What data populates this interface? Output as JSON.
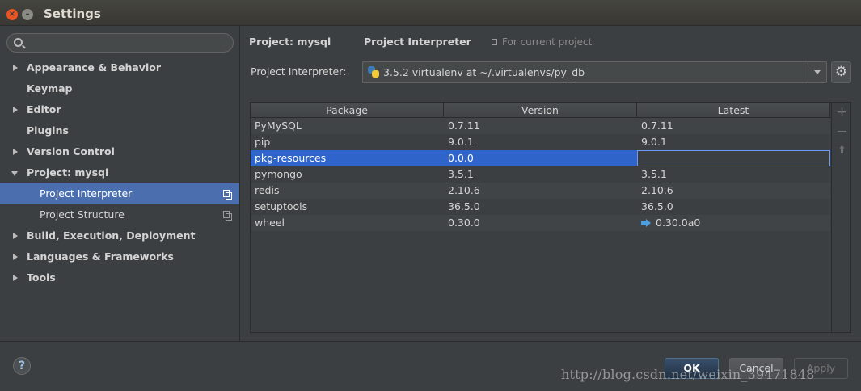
{
  "window": {
    "title": "Settings",
    "close_glyph": "×",
    "minimize_glyph": "–"
  },
  "sidebar": {
    "search_placeholder": "",
    "items": [
      {
        "label": "Appearance & Behavior",
        "expandable": true
      },
      {
        "label": "Keymap",
        "expandable": false
      },
      {
        "label": "Editor",
        "expandable": true
      },
      {
        "label": "Plugins",
        "expandable": false
      },
      {
        "label": "Version Control",
        "expandable": true
      },
      {
        "label": "Project: mysql",
        "expandable": true,
        "expanded": true
      },
      {
        "label": "Project Interpreter",
        "child": true,
        "selected": true
      },
      {
        "label": "Project Structure",
        "child": true
      },
      {
        "label": "Build, Execution, Deployment",
        "expandable": true
      },
      {
        "label": "Languages & Frameworks",
        "expandable": true
      },
      {
        "label": "Tools",
        "expandable": true
      }
    ]
  },
  "main": {
    "breadcrumb_project": "Project: mysql",
    "breadcrumb_page": "Project Interpreter",
    "scope_note": "For current project",
    "interpreter_label": "Project Interpreter:",
    "interpreter_value": "3.5.2 virtualenv at ~/.virtualenvs/py_db",
    "gear_glyph": "⚙"
  },
  "table": {
    "columns": [
      "Package",
      "Version",
      "Latest"
    ],
    "rows": [
      {
        "package": "PyMySQL",
        "version": "0.7.11",
        "latest": "0.7.11"
      },
      {
        "package": "pip",
        "version": "9.0.1",
        "latest": "9.0.1"
      },
      {
        "package": "pkg-resources",
        "version": "0.0.0",
        "latest": "",
        "selected": true
      },
      {
        "package": "pymongo",
        "version": "3.5.1",
        "latest": "3.5.1"
      },
      {
        "package": "redis",
        "version": "2.10.6",
        "latest": "2.10.6"
      },
      {
        "package": "setuptools",
        "version": "36.5.0",
        "latest": "36.5.0"
      },
      {
        "package": "wheel",
        "version": "0.30.0",
        "latest": "0.30.0a0",
        "upgrade": true
      }
    ],
    "tools": {
      "add": "+",
      "remove": "−",
      "upgrade": "⬆"
    }
  },
  "footer": {
    "help_glyph": "?",
    "ok_label": "OK",
    "cancel_label": "Cancel",
    "apply_label": "Apply",
    "watermark": "http://blog.csdn.net/weixin_39471848"
  },
  "colors": {
    "selection": "#4b6eaf",
    "row_selection": "#2f65ca",
    "background": "#3c3f41",
    "upgrade_arrow": "#4a9fe0"
  }
}
